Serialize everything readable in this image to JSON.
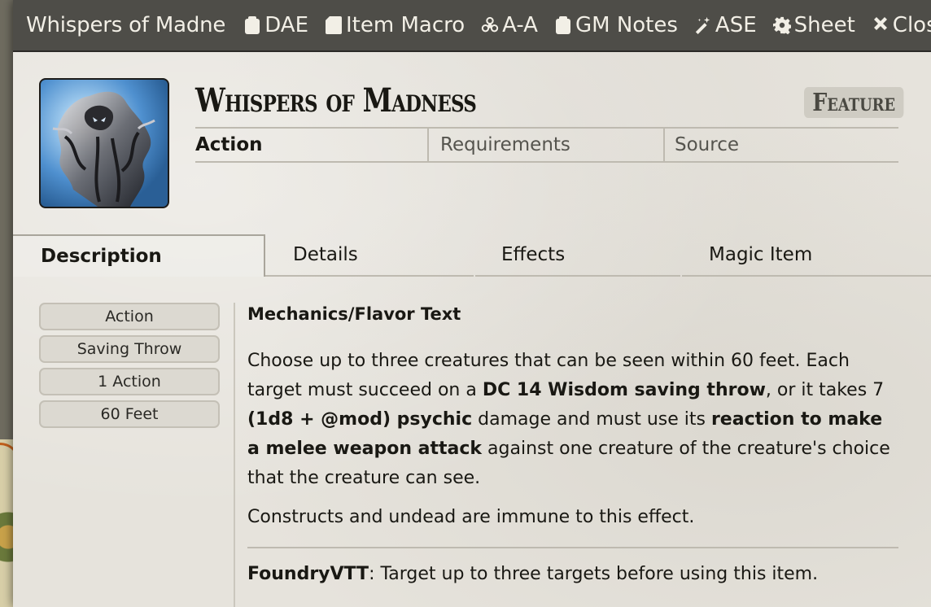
{
  "window": {
    "title": "Whispers of Madne",
    "buttons": [
      {
        "label": "DAE",
        "icon": "clipboard-icon"
      },
      {
        "label": "Item Macro",
        "icon": "sd-card-icon"
      },
      {
        "label": "A-A",
        "icon": "biohazard-icon"
      },
      {
        "label": "GM Notes",
        "icon": "clipboard-icon"
      },
      {
        "label": "ASE",
        "icon": "magic-wand-icon"
      },
      {
        "label": "Sheet",
        "icon": "gear-icon"
      },
      {
        "label": "Close",
        "icon": "close-icon"
      }
    ]
  },
  "item": {
    "name": "Whispers of Madness",
    "type_badge": "Feature",
    "summary": {
      "action": "Action",
      "requirements": "Requirements",
      "source": "Source"
    }
  },
  "tabs": [
    "Description",
    "Details",
    "Effects",
    "Magic Item"
  ],
  "properties": [
    "Action",
    "Saving Throw",
    "1 Action",
    "60 Feet"
  ],
  "description": {
    "heading": "Mechanics/Flavor Text",
    "p1": {
      "t1": "Choose up to three creatures that can be seen within 60 feet. Each target must succeed on a ",
      "b1": "DC 14 Wisdom saving throw",
      "t2": ", or it takes 7 ",
      "b2": "(1d8 + @mod) psychic",
      "t3": " damage and must use its ",
      "b3": "reaction to make a melee weapon attack",
      "t4": " against one creature of the creature's choice that the creature can see."
    },
    "p2": "Constructs and undead are immune to this effect.",
    "foundry_label": "FoundryVTT",
    "foundry_text": ": Target up to three targets before using this item."
  }
}
